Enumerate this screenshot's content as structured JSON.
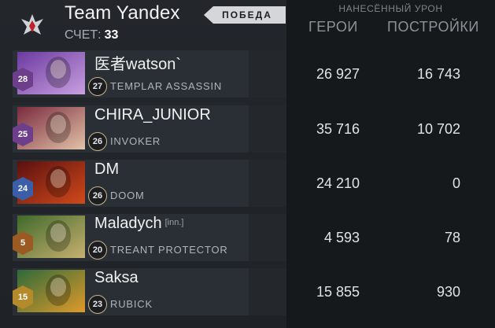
{
  "team": {
    "name": "Team Yandex",
    "score_label": "СЧЕТ:",
    "score_value": "33",
    "result_badge": "ПОБЕДА",
    "logo_icon": "team-logo-icon"
  },
  "damage_header": "НАНЕСЁННЫЙ УРОН",
  "columns": {
    "heroes": "ГЕРОИ",
    "buildings": "ПОСТРОЙКИ"
  },
  "players": [
    {
      "name": "医者watson`",
      "tag": "",
      "hero": "TEMPLAR ASSASSIN",
      "hero_level": "27",
      "rank": "28",
      "hero_damage": "26 927",
      "building_damage": "16 743",
      "portrait_colors": [
        "#6b3aa0",
        "#c9a0e0"
      ],
      "rank_color": "#6d3e8a"
    },
    {
      "name": "CHIRA_JUNIOR",
      "tag": "",
      "hero": "INVOKER",
      "hero_level": "26",
      "rank": "25",
      "hero_damage": "35 716",
      "building_damage": "10 702",
      "portrait_colors": [
        "#7a2a3e",
        "#e2c3a8"
      ],
      "rank_color": "#6d3e8a"
    },
    {
      "name": "DM",
      "tag": "",
      "hero": "DOOM",
      "hero_level": "26",
      "rank": "24",
      "hero_damage": "24 210",
      "building_damage": "0",
      "portrait_colors": [
        "#5a1010",
        "#d14a1a"
      ],
      "rank_color": "#3a5fa8"
    },
    {
      "name": "Maladych",
      "tag": "[inn.]",
      "hero": "TREANT PROTECTOR",
      "hero_level": "20",
      "rank": "5",
      "hero_damage": "4 593",
      "building_damage": "78",
      "portrait_colors": [
        "#3f6a2a",
        "#c8b070"
      ],
      "rank_color": "#9a5a22"
    },
    {
      "name": "Saksa",
      "tag": "",
      "hero": "RUBICK",
      "hero_level": "23",
      "rank": "15",
      "hero_damage": "15 855",
      "building_damage": "930",
      "portrait_colors": [
        "#2e6a3a",
        "#e09a2a"
      ],
      "rank_color": "#b58a2a"
    }
  ]
}
